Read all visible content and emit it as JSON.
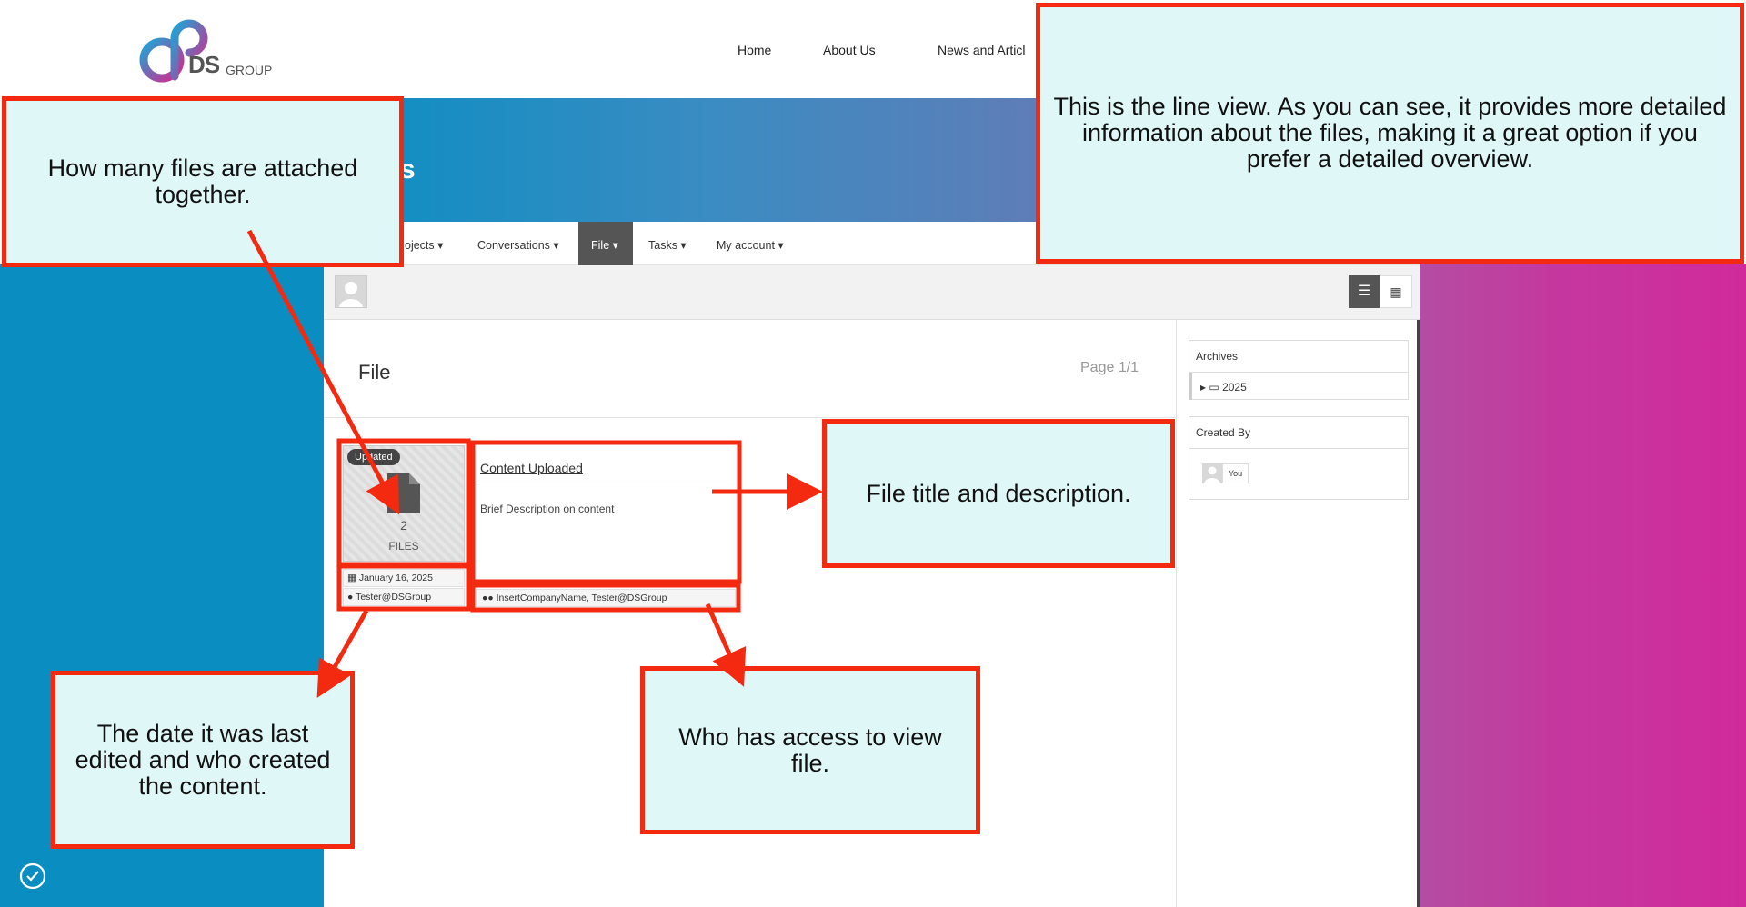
{
  "brand": {
    "logo_text": "DS",
    "logo_sub": "GROUP"
  },
  "nav": {
    "home": "Home",
    "about": "About Us",
    "news": "News and Articl"
  },
  "hero": {
    "title_fragment": "s"
  },
  "menu": {
    "projects": "ojects",
    "conversations": "Conversations",
    "file": "File",
    "tasks": "Tasks",
    "account": "My account"
  },
  "page": {
    "title": "File",
    "pagination": "Page 1/1"
  },
  "card": {
    "badge": "Updated",
    "files_count": "2",
    "files_label": "FILES",
    "date": "January 16, 2025",
    "user": "Tester@DSGroup",
    "title": "Content Uploaded",
    "description": "Brief Description on content",
    "access": "InsertCompanyName, Tester@DSGroup"
  },
  "sidebar": {
    "archives_title": "Archives",
    "archives_year": "2025",
    "created_by_title": "Created By",
    "created_by_user": "You"
  },
  "annotations": {
    "files_attached": "How many files are attached together.",
    "line_view": "This is the line view. As you can see, it provides more detailed information about the files, making it a great option if you prefer a detailed overview.",
    "title_description": "File title and description.",
    "date_creator": "The date it was last edited and who created the content.",
    "access": "Who has access to view file."
  },
  "colors": {
    "accent_red": "#f42a10",
    "note_bg": "#e0f7f8",
    "blue": "#0a8ec2",
    "magenta": "#d12a9a"
  }
}
